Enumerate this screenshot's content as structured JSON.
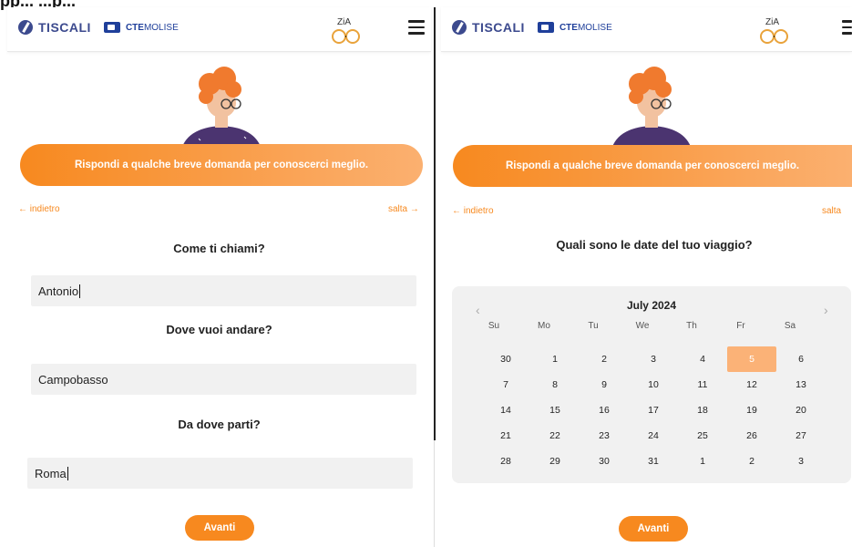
{
  "caption": "pp... ...p...",
  "brand": {
    "tiscali": "TISCALI",
    "cte": "CTE",
    "molise": "MOLISE"
  },
  "banner_text": "Rispondi a qualche breve domanda per conoscerci meglio.",
  "nav": {
    "back": "← indietro",
    "skip": "salta →"
  },
  "left_form": {
    "q1": "Come ti chiami?",
    "a1": "Antonio",
    "q2": "Dove vuoi andare?",
    "a2": "Campobasso",
    "q3": "Da dove parti?",
    "a3": "Roma",
    "button": "Avanti"
  },
  "right_form": {
    "question": "Quali sono le date del tuo viaggio?",
    "button": "Avanti"
  },
  "calendar": {
    "month": "July 2024",
    "prev": "‹",
    "next": "›",
    "weekdays": [
      "Su",
      "Mo",
      "Tu",
      "We",
      "Th",
      "Fr",
      "Sa"
    ],
    "selected": "5",
    "weeks": [
      [
        "30",
        "1",
        "2",
        "3",
        "4",
        "5",
        "6"
      ],
      [
        "7",
        "8",
        "9",
        "10",
        "11",
        "12",
        "13"
      ],
      [
        "14",
        "15",
        "16",
        "17",
        "18",
        "19",
        "20"
      ],
      [
        "21",
        "22",
        "23",
        "24",
        "25",
        "26",
        "27"
      ],
      [
        "28",
        "29",
        "30",
        "31",
        "1",
        "2",
        "3"
      ]
    ]
  },
  "colors": {
    "accent": "#f7891f",
    "field": "#f1f1f1",
    "brand_blue": "#3c4a8e"
  },
  "icons": [
    "tiscali-logo-icon",
    "cte-molise-logo-icon",
    "zia-glasses-logo-icon",
    "hamburger-menu-icon",
    "avatar-illustration"
  ]
}
